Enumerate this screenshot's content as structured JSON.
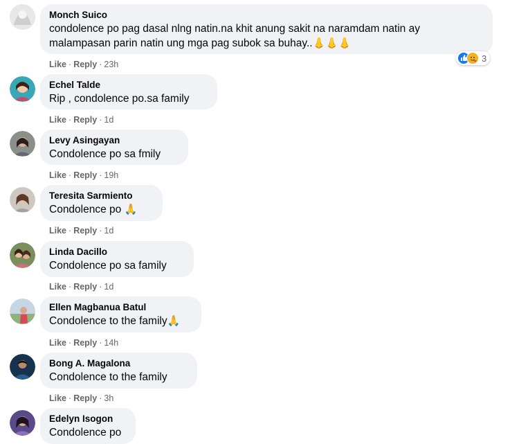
{
  "comments": [
    {
      "author": "Monch Suico",
      "line1": "condolence po pag dasal nlng natin.na khit anung sakit na naramdam natin ay",
      "line2": "malampasan parin natin ung mga pag subok sa buhay..",
      "emoji": "👃👃👃",
      "like": "Like",
      "reply": "Reply",
      "time": "23h",
      "reaction_count": "3"
    },
    {
      "author": "Echel Talde",
      "text": "Rip , condolence po.sa family",
      "like": "Like",
      "reply": "Reply",
      "time": "1d"
    },
    {
      "author": "Levy Asingayan",
      "text": "Condolence po sa fmily",
      "like": "Like",
      "reply": "Reply",
      "time": "19h"
    },
    {
      "author": "Teresita Sarmiento",
      "text": "Condolence po",
      "emoji": "🙏",
      "like": "Like",
      "reply": "Reply",
      "time": "1d"
    },
    {
      "author": "Linda Dacillo",
      "text": "Condolence po sa family",
      "like": "Like",
      "reply": "Reply",
      "time": "1d"
    },
    {
      "author": "Ellen Magbanua Batul",
      "text": "Condolence to the family",
      "emoji": "🙏",
      "like": "Like",
      "reply": "Reply",
      "time": "14h"
    },
    {
      "author": "Bong A. Magalona",
      "text": "Condolence to the family",
      "like": "Like",
      "reply": "Reply",
      "time": "3h"
    },
    {
      "author": "Edelyn Isogon",
      "text": "Condolence po"
    }
  ],
  "separator": "·",
  "icons": {
    "like_reaction": "like-icon",
    "care_reaction": "care-icon",
    "avatar": "avatar"
  },
  "colors": {
    "bubble": "#f0f2f5",
    "meta": "#65676b",
    "like_blue": "#1877f2",
    "care_yellow": "#f7b125"
  }
}
